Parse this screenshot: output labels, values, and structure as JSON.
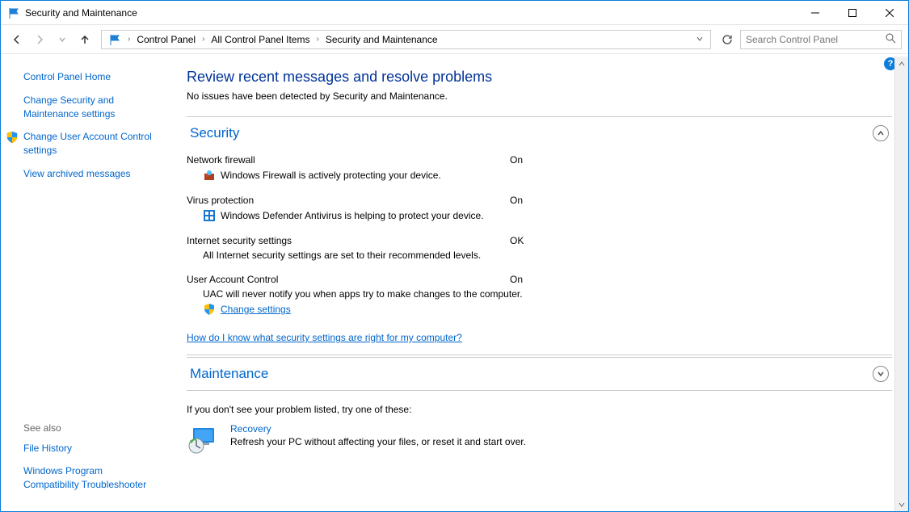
{
  "window": {
    "title": "Security and Maintenance"
  },
  "breadcrumb": {
    "items": [
      "Control Panel",
      "All Control Panel Items",
      "Security and Maintenance"
    ]
  },
  "search": {
    "placeholder": "Search Control Panel"
  },
  "sidebar": {
    "home": "Control Panel Home",
    "links": [
      "Change Security and Maintenance settings",
      "Change User Account Control settings",
      "View archived messages"
    ],
    "seealso_label": "See also",
    "seealso": [
      "File History",
      "Windows Program Compatibility Troubleshooter"
    ]
  },
  "main": {
    "heading": "Review recent messages and resolve problems",
    "subheading": "No issues have been detected by Security and Maintenance.",
    "security": {
      "title": "Security",
      "items": [
        {
          "label": "Network firewall",
          "status": "On",
          "detail": "Windows Firewall is actively protecting your device."
        },
        {
          "label": "Virus protection",
          "status": "On",
          "detail": "Windows Defender Antivirus is helping to protect your device."
        },
        {
          "label": "Internet security settings",
          "status": "OK",
          "detail": "All Internet security settings are set to their recommended levels."
        },
        {
          "label": "User Account Control",
          "status": "On",
          "detail": "UAC will never notify you when apps try to make changes to the computer.",
          "action": "Change settings"
        }
      ],
      "help_link": "How do I know what security settings are right for my computer?"
    },
    "maintenance": {
      "title": "Maintenance"
    },
    "footer": "If you don't see your problem listed, try one of these:",
    "recovery": {
      "title": "Recovery",
      "desc": "Refresh your PC without affecting your files, or reset it and start over."
    }
  }
}
